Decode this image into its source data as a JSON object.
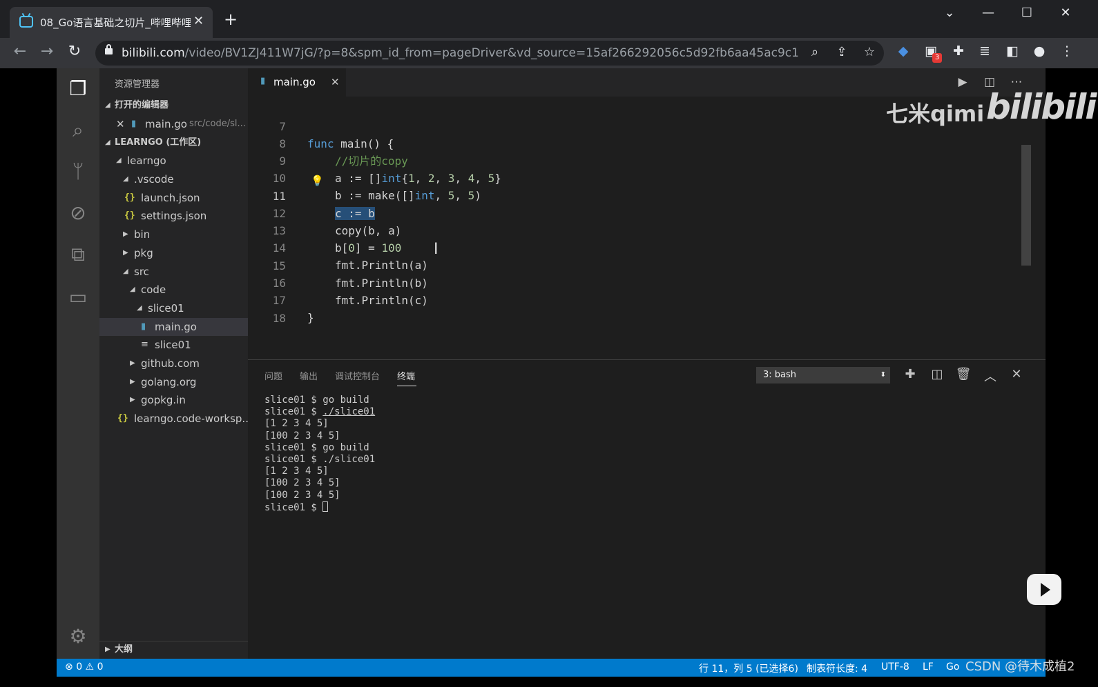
{
  "browser": {
    "tab_title": "08_Go语言基础之切片_哔哩哔哩",
    "tab_close": "✕",
    "new_tab": "+",
    "url_host": "bilibili.com",
    "url_path": "/video/BV1ZJ411W7jG/?p=8&spm_id_from=pageDriver&vd_source=15af266292056c5d92fb6aa45ac9c1d0",
    "extension_badge": "3"
  },
  "vscode": {
    "sidebar": {
      "title": "资源管理器",
      "open_editors_header": "打开的编辑器",
      "open_editor": {
        "name": "main.go",
        "path": "src/code/sl..."
      },
      "workspace_header": "LEARNGO (工作区)",
      "tree": [
        {
          "label": "learngo"
        },
        {
          "label": ".vscode"
        },
        {
          "label": "launch.json"
        },
        {
          "label": "settings.json"
        },
        {
          "label": "bin"
        },
        {
          "label": "pkg"
        },
        {
          "label": "src"
        },
        {
          "label": "code"
        },
        {
          "label": "slice01"
        },
        {
          "label": "main.go"
        },
        {
          "label": "slice01"
        },
        {
          "label": "github.com"
        },
        {
          "label": "golang.org"
        },
        {
          "label": "gopkg.in"
        },
        {
          "label": "learngo.code-worksp..."
        }
      ],
      "outline_header": "大纲"
    },
    "editor": {
      "tab_label": "main.go",
      "lines": [
        {
          "num": "7",
          "code": "func main() {"
        },
        {
          "num": "8",
          "code": "//切片的copy"
        },
        {
          "num": "9",
          "code": "a := []int{1, 2, 3, 4, 5}"
        },
        {
          "num": "10",
          "code": "b := make([]int, 5, 5)"
        },
        {
          "num": "11",
          "code": "c := b"
        },
        {
          "num": "12",
          "code": "copy(b, a)"
        },
        {
          "num": "13",
          "code": "b[0] = 100"
        },
        {
          "num": "14",
          "code": "fmt.Println(a)"
        },
        {
          "num": "15",
          "code": "fmt.Println(b)"
        },
        {
          "num": "16",
          "code": "fmt.Println(c)"
        },
        {
          "num": "17",
          "code": "}"
        },
        {
          "num": "18",
          "code": ""
        }
      ]
    },
    "panel": {
      "tabs": [
        "问题",
        "输出",
        "调试控制台",
        "终端"
      ],
      "active_tab": "终端",
      "terminal_select": "3: bash",
      "terminal_lines": [
        "slice01 $ go build",
        "./slice01",
        "[1 2 3 4 5]",
        "[100 2 3 4 5]",
        "slice01 $ go build",
        "slice01 $ ./slice01",
        "[1 2 3 4 5]",
        "[100 2 3 4 5]",
        "[100 2 3 4 5]",
        "slice01 $ "
      ],
      "prompt": "slice01 $ "
    },
    "statusbar": {
      "errors": "0",
      "warnings": "0",
      "position": "行 11，列 5 (已选择6)",
      "tab_size": "制表符长度: 4",
      "encoding": "UTF-8",
      "eol": "LF",
      "language": "Go"
    }
  },
  "overlays": {
    "watermark_qimi": "七米qimi",
    "watermark_bilibili": "bilibili",
    "csdn": "CSDN @待木成植2"
  },
  "colors": {
    "accent": "#007acc",
    "keyword": "#569cd6",
    "comment": "#6a9955",
    "number": "#b5cea8",
    "selection": "#264f78"
  },
  "icons": [
    "explorer-icon",
    "search-icon",
    "source-control-icon",
    "debug-icon",
    "extensions-icon",
    "folder-icon",
    "gear-icon",
    "go-file-icon",
    "json-icon",
    "lightbulb-icon",
    "play-icon"
  ]
}
